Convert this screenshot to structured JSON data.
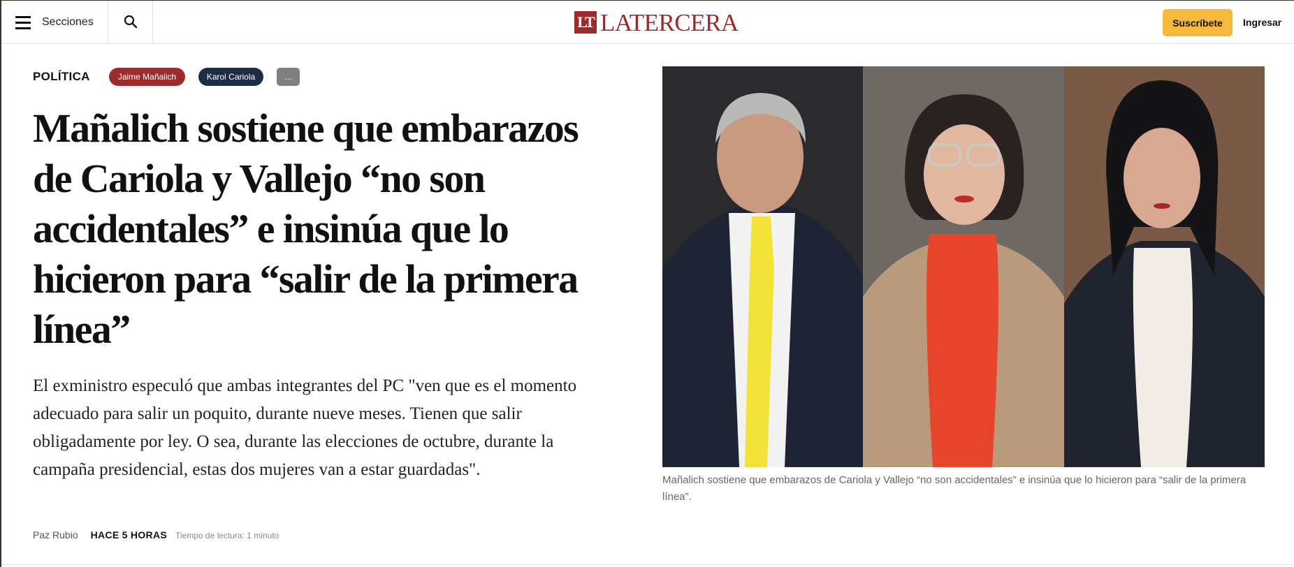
{
  "header": {
    "menu_label": "Secciones",
    "logo_mark": "LT",
    "logo_text": "LATERCERA",
    "subscribe_label": "Suscríbete",
    "login_label": "Ingresar",
    "brand_color": "#9e2a2b",
    "subscribe_color": "#f6b93b"
  },
  "article": {
    "section": "POLÍTICA",
    "tags": [
      {
        "label": "Jaime Mañalich",
        "color": "#9e2a2b"
      },
      {
        "label": "Karol Cariola",
        "color": "#1f2d44"
      }
    ],
    "more_tags_label": "...",
    "headline": "Mañalich sostiene que embarazos de Cariola y Vallejo “no son accidentales” e insinúa que lo hicieron para “salir de la primera línea”",
    "dek": "El exministro especuló que ambas integrantes del PC \"ven que es el momento adecuado para salir un poquito, durante nueve meses. Tienen que salir obligadamente por ley. O sea, durante las elecciones de octubre, durante la campaña presidencial, estas dos mujeres van a estar guardadas\".",
    "author": "Paz Rubio",
    "published": "HACE 5 HORAS",
    "reading_time": "Tiempo de lectura: 1 minuto",
    "image_caption": "Mañalich sostiene que embarazos de Cariola y Vallejo “no son accidentales” e insinúa que lo hicieron para “salir de la primera línea”."
  },
  "icons": {
    "menu": "hamburger-icon",
    "search": "search-icon"
  }
}
